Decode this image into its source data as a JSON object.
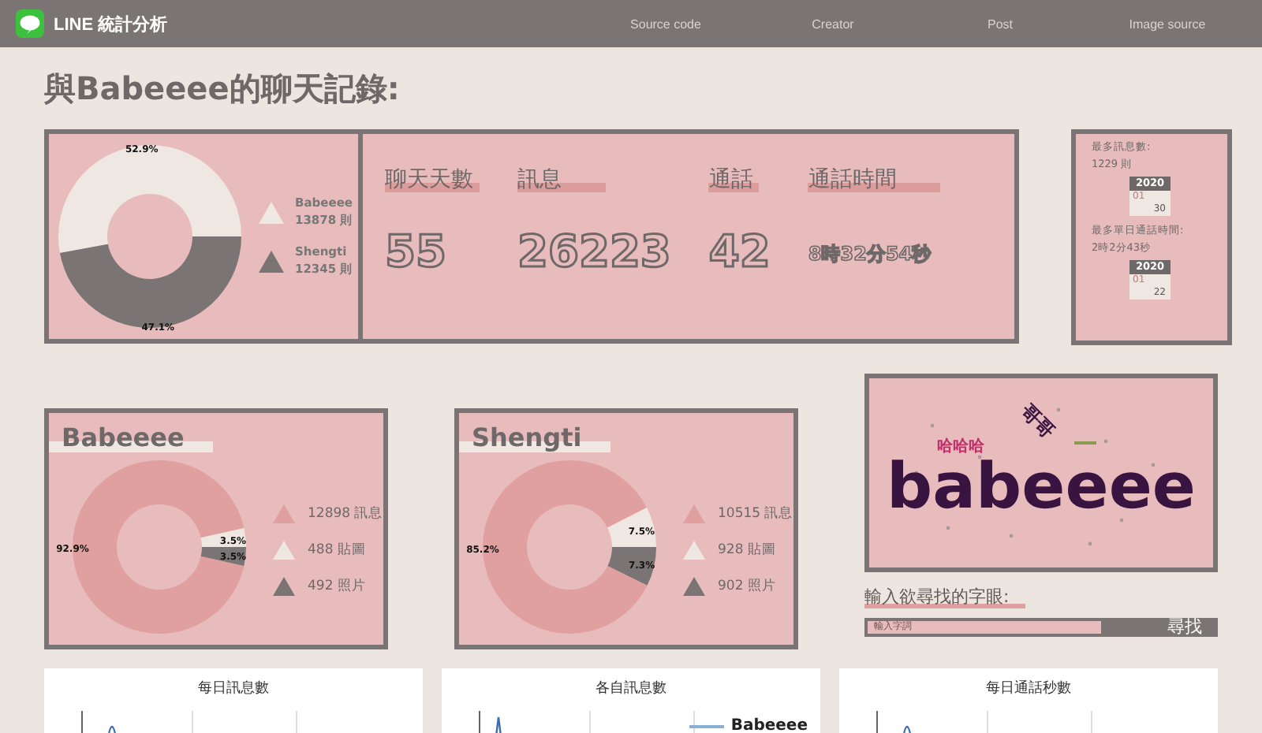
{
  "nav": {
    "brand": "LINE 統計分析",
    "links": [
      "Source code",
      "Creator",
      "Post",
      "Image source"
    ]
  },
  "title": "與Babeeee的聊天記錄:",
  "summary": {
    "chart_data": {
      "type": "donut",
      "categories": [
        "Babeeee",
        "Shengti"
      ],
      "values": [
        52.9,
        47.1
      ],
      "value_labels": [
        "52.9%",
        "47.1%"
      ]
    },
    "legend": [
      {
        "count": "13878 則",
        "color": "#efe7e1"
      },
      {
        "count": "12345 則",
        "color": "#7a7574"
      }
    ]
  },
  "stats": [
    {
      "label": "聊天天數",
      "value": "55"
    },
    {
      "label": "訊息",
      "value": "26223"
    },
    {
      "label": "通話",
      "value": "42"
    },
    {
      "label": "通話時間",
      "value": "8時32分54秒"
    }
  ],
  "records": [
    {
      "label": "最多訊息數:",
      "value": "1229 則",
      "year": "2020",
      "month": "01",
      "day": "30"
    },
    {
      "label": "最多單日通話時間:",
      "value": "2時2分43秒",
      "year": "2020",
      "month": "01",
      "day": "22"
    }
  ],
  "users": [
    {
      "name": "Babeeee",
      "chart_data": {
        "type": "donut",
        "categories": [
          "訊息",
          "貼圖",
          "照片"
        ],
        "values": [
          92.9,
          3.5,
          3.5
        ],
        "value_labels": [
          "92.9%",
          "3.5%",
          "3.5%"
        ]
      },
      "legend": [
        {
          "count": "12898",
          "color": "#e0a0a0"
        },
        {
          "count": "488",
          "color": "#efe7e1"
        },
        {
          "count": "492",
          "color": "#7a7574"
        }
      ]
    },
    {
      "name": "Shengti",
      "chart_data": {
        "type": "donut",
        "categories": [
          "訊息",
          "貼圖",
          "照片"
        ],
        "values": [
          85.2,
          7.5,
          7.3
        ],
        "value_labels": [
          "85.2%",
          "7.5%",
          "7.3%"
        ]
      },
      "legend": [
        {
          "count": "10515",
          "color": "#e0a0a0"
        },
        {
          "count": "928",
          "color": "#efe7e1"
        },
        {
          "count": "902",
          "color": "#7a7574"
        }
      ]
    }
  ],
  "wordcloud": {
    "words": [
      {
        "text": "babeeee",
        "color": "#3a1440"
      },
      {
        "text": "哈哈哈",
        "color": "#c0306a"
      },
      {
        "text": "哥哥",
        "color": "#3a1440"
      }
    ]
  },
  "search": {
    "label": "輸入欲尋找的字眼:",
    "placeholder": "輸入字詞",
    "button": "尋找"
  },
  "charts": [
    {
      "title": "每日訊息數"
    },
    {
      "title": "各自訊息數",
      "legend": "Babeeee"
    },
    {
      "title": "每日通話秒數"
    }
  ]
}
